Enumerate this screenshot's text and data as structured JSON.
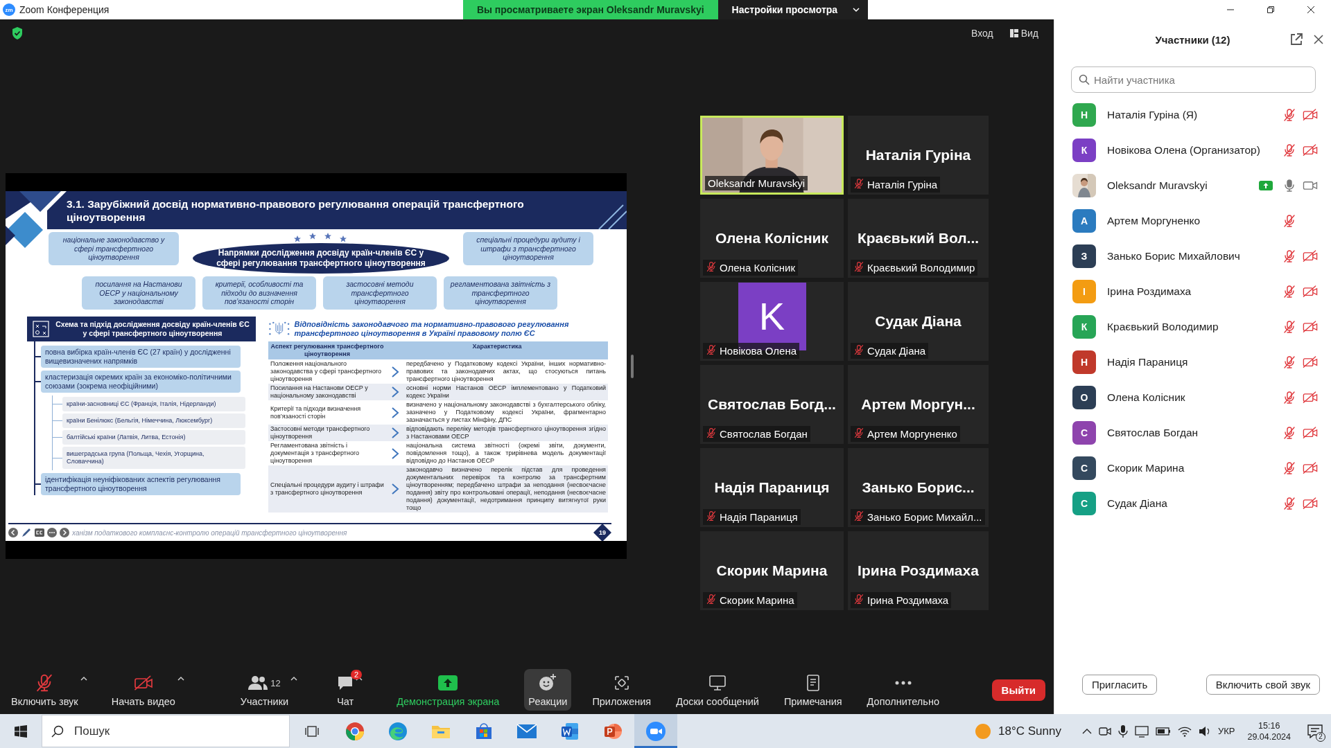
{
  "window": {
    "logo": "zm",
    "title": "Zoom Конференция"
  },
  "share_banner": {
    "text": "Вы просматриваете экран Oleksandr Muravskyi",
    "menu": "Настройки просмотра"
  },
  "top_bar": {
    "buttons": [
      {
        "label": "Вход",
        "kind": "text"
      },
      {
        "label": "Вид",
        "kind": "view"
      }
    ]
  },
  "slide": {
    "title": "3.1. Зарубіжний досвід нормативно-правового регулювання операцій трансфертного ціноутворення",
    "center": "Напрямки дослідження досвіду країн-членів ЄС у сфері регулювання трансфертного ціноутворення",
    "directions": [
      "національне законодавство у сфері трансфертного ціноутворення",
      "спеціальні процедури аудиту і штрафи з трансфертного ціноутворення",
      "посилання на Настанови ОЕСР у національному законодавстві",
      "критерії, особливості та підходи до визначення пов’язаності сторін",
      "застосовні методи трансфертного ціноутворення",
      "регламентована звітність з трансфертного ціноутворення"
    ],
    "scheme": {
      "title": "Схема та підхід дослідження досвіду країн-членів ЄС у сфері трансфертного ціноутворення",
      "items": [
        {
          "text": "повна вибірка країн-членів ЄС (27 країн) у дослідженні вищевизначених напрямків"
        },
        {
          "text": "кластеризація окремих країн за економіко-політичними союзами (зокрема неофіційними)",
          "children": [
            {
              "text": "країни-засновниці ЄС (Франція, Італія, Нідерланди)"
            },
            {
              "text": "країни Бенілюкс (Бельгія, Німеччина, Люксембург)"
            },
            {
              "text": "балтійські країни (Латвія, Литва, Естонія)"
            },
            {
              "text": "вишеградська група (Польща, Чехія, Угорщина, Словаччина)"
            }
          ]
        },
        {
          "text": "ідентифікація неуніфікованих аспектів регулювання трансфертного ціноутворення"
        }
      ]
    },
    "table": {
      "title": "Відповідність законодавчого та нормативно-правового регулювання трансфертного ціноутворення в Україні правовому полю ЄС",
      "columns": [
        "Аспект регулювання трансфертного ціноутворення",
        "Характеристика"
      ],
      "rows": [
        {
          "aspect": "Положення національного законодавства у сфері трансфертного ціноутворення",
          "description": "передбачено у Податковому кодексі України, інших нормативно-правових та законодавчих актах, що стосуються питань трансфертного ціноутворення"
        },
        {
          "aspect": "Посилання на Настанови ОЕСР у національному законодавстві",
          "description": "основні норми Настанов ОЕСР імплементовано у Податковий кодекс України"
        },
        {
          "aspect": "Критерії та підходи визначення пов’язаності сторін",
          "description": "визначено у національному законодавстві з бухгалтерського обліку, зазначено у Податковому кодексі України, фрагментарно зазначається у листах Мінфіну, ДПС"
        },
        {
          "aspect": "Застосовні методи трансфертного ціноутворення",
          "description": "відповідають переліку методів трансфертного ціноутворення згідно з Настановами ОЕСР"
        },
        {
          "aspect": "Регламентована звітність і документація з трансфертного ціноутворення",
          "description": "національна система звітності (окремі звіти, документи, повідомлення тощо), а також трирівнева модель документації відповідно до Настанов ОЕСР"
        },
        {
          "aspect": "Спеціальні процедури аудиту і штрафи з трансфертного ціноутворення",
          "description": "законодавчо визначено перелік підстав для проведення документальних перевірок та контролю за трансфертним ціноутворенням; передбачено штрафи за неподання (несвоєчасне подання) звіту про контрольовані операції, неподання (несвоєчасне подання) документації, недотримання принципу витягнутої руки тощо"
        }
      ]
    },
    "footer": "ханізм податкового комплаєнс-контролю операцій трансфертного ціноутворення",
    "page": "19"
  },
  "videos": [
    {
      "kind": "video",
      "label": "Oleksandr Muravskyi",
      "speaking": true,
      "muted": false
    },
    {
      "kind": "name",
      "display_name": "Наталія Гуріна",
      "label": "Наталія Гуріна",
      "speaking": false,
      "muted": true
    },
    {
      "kind": "name",
      "display_name": "Олена Колісник",
      "label": "Олена Колісник",
      "speaking": false,
      "muted": true
    },
    {
      "kind": "name",
      "display_name": "Краєвький Вол...",
      "label": "Краєвький Володимир",
      "speaking": false,
      "muted": true
    },
    {
      "kind": "avatar",
      "initial": "K",
      "color": "#7b3fc4",
      "label": "Новікова Олена",
      "speaking": false,
      "muted": true
    },
    {
      "kind": "name",
      "display_name": "Судак Діана",
      "label": "Судак Діана",
      "speaking": false,
      "muted": true
    },
    {
      "kind": "name",
      "display_name": "Святослав Богд...",
      "label": "Святослав Богдан",
      "speaking": false,
      "muted": true
    },
    {
      "kind": "name",
      "display_name": "Артем Моргун...",
      "label": "Артем Моргуненко",
      "speaking": false,
      "muted": true
    },
    {
      "kind": "name",
      "display_name": "Надія Параниця",
      "label": "Надія Параниця",
      "speaking": false,
      "muted": true
    },
    {
      "kind": "name",
      "display_name": "Занько Борис...",
      "label": "Занько Борис Михайл...",
      "speaking": false,
      "muted": true
    },
    {
      "kind": "name",
      "display_name": "Скорик Марина",
      "label": "Скорик Марина",
      "speaking": false,
      "muted": true
    },
    {
      "kind": "name",
      "display_name": "Ірина Роздимаха",
      "label": "Ірина Роздимаха",
      "speaking": false,
      "muted": true
    }
  ],
  "toolbar": {
    "items": [
      {
        "kind": "mic_muted",
        "label": "Включить звук",
        "caret": true,
        "selected": false
      },
      {
        "kind": "video_off",
        "label": "Начать видео",
        "caret": true,
        "selected": false
      },
      {
        "kind": "participants",
        "label": "Участники",
        "count": "12",
        "caret": true,
        "selected": false
      },
      {
        "kind": "chat",
        "label": "Чат",
        "badge": "2",
        "caret": true,
        "selected": false
      },
      {
        "kind": "share",
        "label": "Демонстрация экрана",
        "caret": false,
        "selected": false
      },
      {
        "kind": "reactions",
        "label": "Реакции",
        "caret": false,
        "selected": true
      },
      {
        "kind": "apps",
        "label": "Приложения",
        "caret": false,
        "selected": false
      },
      {
        "kind": "whiteboards",
        "label": "Доски сообщений",
        "caret": false,
        "selected": false
      },
      {
        "kind": "notes",
        "label": "Примечания",
        "caret": false,
        "selected": false
      },
      {
        "kind": "more",
        "label": "Дополнительно",
        "caret": false,
        "selected": false
      }
    ],
    "leave": "Выйти"
  },
  "participants": {
    "title": "Участники (12)",
    "search": {
      "placeholder": "Найти участника"
    },
    "items": [
      {
        "kind": "initial",
        "initial": "Н",
        "color": "#2fa84f",
        "name": "Наталія Гуріна (Я)",
        "muted": true,
        "camera_icon": true,
        "video_off": true,
        "sharing": false
      },
      {
        "kind": "initial",
        "initial": "К",
        "color": "#7b3fc4",
        "name": "Новікова Олена (Организатор)",
        "muted": true,
        "camera_icon": true,
        "video_off": true,
        "sharing": false
      },
      {
        "name": "Oleksandr Muravskyi",
        "muted": false,
        "camera_icon": true,
        "video_off": false,
        "sharing": true
      },
      {
        "kind": "initial",
        "initial": "А",
        "color": "#2b7bbf",
        "name": "Артем Моргуненко",
        "muted": true,
        "camera_icon": false,
        "sharing": false
      },
      {
        "kind": "initial",
        "initial": "З",
        "color": "#2c3e55",
        "name": "Занько Борис Михайлович",
        "muted": true,
        "camera_icon": true,
        "video_off": true,
        "sharing": false
      },
      {
        "kind": "initial",
        "initial": "І",
        "color": "#f39c12",
        "name": "Ірина Роздимаха",
        "muted": true,
        "camera_icon": true,
        "video_off": true,
        "sharing": false
      },
      {
        "kind": "initial",
        "initial": "К",
        "color": "#27a556",
        "name": "Краєвький Володимир",
        "muted": true,
        "camera_icon": true,
        "video_off": true,
        "sharing": false
      },
      {
        "kind": "initial",
        "initial": "Н",
        "color": "#c0392b",
        "name": "Надія Параниця",
        "muted": true,
        "camera_icon": true,
        "video_off": true,
        "sharing": false
      },
      {
        "kind": "initial",
        "initial": "О",
        "color": "#2c3e55",
        "name": "Олена Колісник",
        "muted": true,
        "camera_icon": true,
        "video_off": true,
        "sharing": false
      },
      {
        "kind": "initial",
        "initial": "С",
        "color": "#8e44ad",
        "name": "Святослав Богдан",
        "muted": true,
        "camera_icon": true,
        "video_off": true,
        "sharing": false
      },
      {
        "kind": "initial",
        "initial": "С",
        "color": "#34495e",
        "name": "Скорик Марина",
        "muted": true,
        "camera_icon": true,
        "video_off": true,
        "sharing": false
      },
      {
        "kind": "initial",
        "initial": "С",
        "color": "#16a085",
        "name": "Судак Діана",
        "muted": true,
        "camera_icon": true,
        "video_off": true,
        "sharing": false
      }
    ],
    "buttons": [
      "Пригласить",
      "Включить свой звук"
    ]
  },
  "taskbar": {
    "search": {
      "placeholder": "Пошук"
    },
    "apps": [
      {
        "kind": "taskview",
        "selected": false
      },
      {
        "kind": "chrome",
        "selected": false
      },
      {
        "kind": "edge",
        "selected": false
      },
      {
        "kind": "explorer",
        "selected": false
      },
      {
        "kind": "store",
        "selected": false
      },
      {
        "kind": "mail",
        "selected": false
      },
      {
        "kind": "word",
        "selected": false
      },
      {
        "kind": "powerpoint",
        "selected": false
      },
      {
        "kind": "zoom",
        "selected": true
      }
    ],
    "weather": "18°C Sunny",
    "language": "УКР",
    "time": "15:16",
    "date": "29.04.2024",
    "notifications": "2"
  }
}
